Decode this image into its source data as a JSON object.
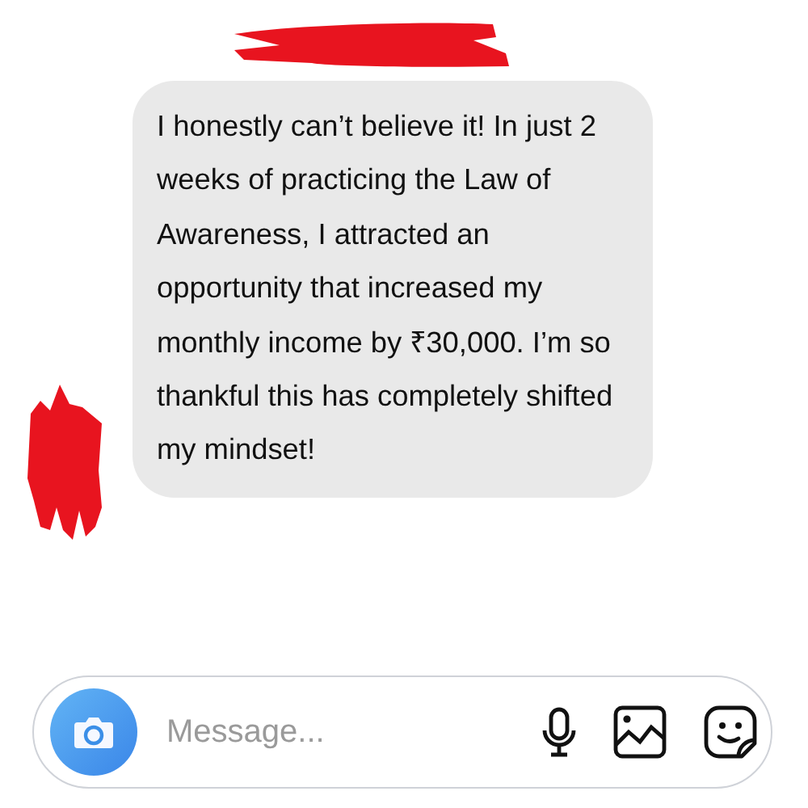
{
  "messages": [
    {
      "kind": "received",
      "text": "I honestly can’t believe it! In just 2 weeks of practicing the Law of Awareness, I attracted an opportunity that increased my monthly income by ₹30,000. I’m so thankful this has completely shifted my mindset!"
    }
  ],
  "composer": {
    "placeholder": "Message..."
  }
}
